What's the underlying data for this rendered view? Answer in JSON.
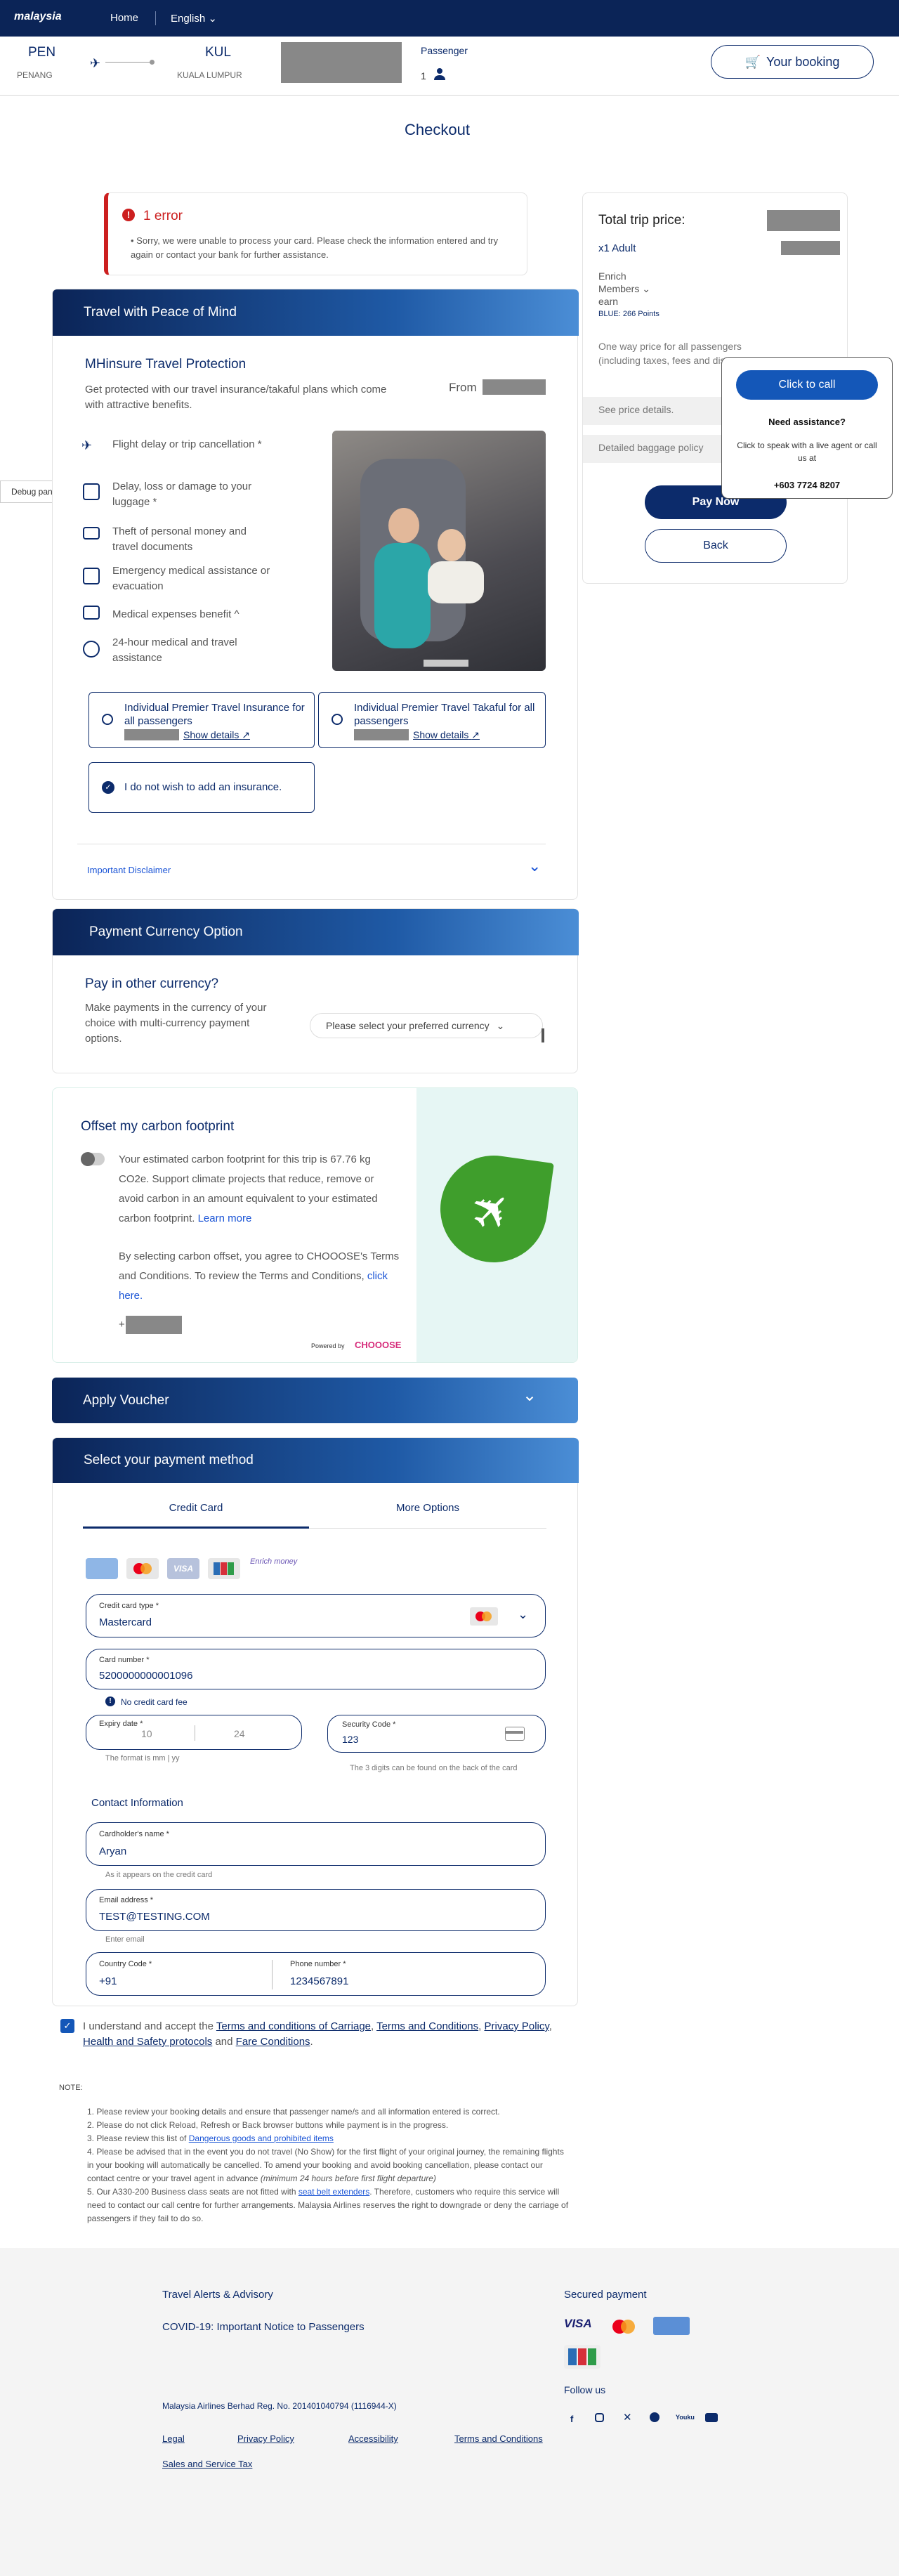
{
  "topbar": {
    "logo": "malaysia",
    "home": "Home",
    "language": "English"
  },
  "flight": {
    "origin_code": "PEN",
    "origin_city": "PENANG",
    "dest_code": "KUL",
    "dest_city": "KUALA LUMPUR",
    "passenger_label": "Passenger",
    "passenger_count": "1",
    "booking_button": "Your booking"
  },
  "page_title": "Checkout",
  "error": {
    "title": "1 error",
    "message": "Sorry, we were unable to process your card. Please check the information entered and try again or contact your bank for further assistance."
  },
  "summary": {
    "total_label": "Total trip price:",
    "adult": "x1 Adult",
    "enrich_line1": "Enrich",
    "enrich_line2": "Members",
    "enrich_line3": "earn",
    "blue_points": "BLUE: 266 Points",
    "oneway_note": "One way price for all passengers (including taxes, fees and discounts).",
    "see_price": "See price details.",
    "baggage": "Detailed baggage policy",
    "pay_now": "Pay Now",
    "back": "Back"
  },
  "assist": {
    "call_button": "Click to call",
    "need": "Need assistance?",
    "text": "Click to speak with a live agent or call us at",
    "phone": "+603 7724 8207"
  },
  "debug": "Debug panel",
  "insurance": {
    "banner": "Travel with Peace of Mind",
    "title": "MHinsure Travel Protection",
    "desc": "Get protected with our travel insurance/takaful plans which come with attractive benefits.",
    "from": "From",
    "features": [
      "Flight delay or trip cancellation *",
      "Delay, loss or damage to your luggage *",
      "Theft of personal money and travel documents",
      "Emergency medical assistance or evacuation",
      "Medical expenses benefit ^",
      "24-hour medical and travel assistance"
    ],
    "option1": "Individual Premier Travel Insurance for all passengers",
    "option2": "Individual Premier Travel Takaful for all passengers",
    "show_details": "Show details",
    "no_insurance": "I do not wish to add an insurance.",
    "disclaimer": "Important Disclaimer"
  },
  "currency": {
    "banner": "Payment Currency Option",
    "title": "Pay in other currency?",
    "desc": "Make payments in the currency of your choice with multi-currency payment options.",
    "placeholder": "Please select your preferred currency"
  },
  "carbon": {
    "title": "Offset my carbon footprint",
    "text1": "Your estimated carbon footprint for this trip is 67.76 kg CO2e. Support climate projects that reduce, remove or avoid carbon in an amount equivalent to your estimated carbon footprint.",
    "learn": "Learn more",
    "text2": "By selecting carbon offset, you agree to CHOOOSE's Terms and Conditions. To review the Terms and Conditions,",
    "click": "click here.",
    "plus": "+",
    "powered": "Powered by",
    "brand": "CHOOOSE"
  },
  "voucher": {
    "banner": "Apply Voucher"
  },
  "payment": {
    "banner": "Select your payment method",
    "tab_card": "Credit Card",
    "tab_more": "More Options",
    "card_type_label": "Credit card type *",
    "card_type": "Mastercard",
    "card_number_label": "Card number *",
    "card_number": "5200000000001096",
    "fee": "No credit card fee",
    "expiry_label": "Expiry date *",
    "expiry_month": "10",
    "expiry_year": "24",
    "expiry_hint": "The format is mm | yy",
    "cvv_label": "Security Code *",
    "cvv": "123",
    "cvv_hint": "The 3 digits can be found on the back of the card",
    "contact_title": "Contact Information",
    "name_label": "Cardholder's name *",
    "name": "Aryan",
    "name_hint": "As it appears on the credit card",
    "email_label": "Email address *",
    "email": "TEST@TESTING.COM",
    "email_hint": "Enter email",
    "country_label": "Country Code *",
    "country": "+91",
    "phone_label": "Phone number *",
    "phone": "1234567891",
    "brand_enrich": "Enrich money"
  },
  "terms": {
    "prefix": "I understand and accept the",
    "l1": "Terms and conditions of Carriage",
    "c1": ",",
    "l2": "Terms and Conditions",
    "c2": ",",
    "l3": "Privacy Policy",
    "c3": ",",
    "l4": "Health and Safety protocols",
    "and": "and",
    "l5": "Fare Conditions",
    "end": "."
  },
  "notes": {
    "title": "NOTE:",
    "n1": "1. Please review your booking details and ensure that passenger name/s and all information entered is correct.",
    "n2": "2. Please do not click Reload, Refresh or Back browser buttons while payment is in the progress.",
    "n3a": "3. Please review this list of",
    "n3b": "Dangerous goods and prohibited items",
    "n4": "4. Please be advised that in the event you do not travel (No Show) for the first flight of your original journey, the remaining flights in your booking will automatically be cancelled. To amend your booking and avoid booking cancellation, please contact our contact centre or your travel agent in advance",
    "n4i": "(minimum 24 hours before first flight departure)",
    "n5a": "5. Our A330-200 Business class seats are not fitted with",
    "n5b": "seat belt extenders",
    "n5c": ". Therefore, customers who require this service will need to contact our call centre for further arrangements. Malaysia Airlines reserves the right to downgrade or deny the carriage of passengers if they fail to do so."
  },
  "footer": {
    "alerts": "Travel Alerts & Advisory",
    "covid": "COVID-19: Important Notice to Passengers",
    "secured": "Secured payment",
    "follow": "Follow us",
    "reg": "Malaysia Airlines Berhad Reg. No. 201401040794 (1116944-X)",
    "legal": "Legal",
    "privacy": "Privacy Policy",
    "access": "Accessibility",
    "tnc": "Terms and Conditions",
    "sst": "Sales and Service Tax",
    "visa": "VISA",
    "brand_colors": {
      "navy": "#0b2457",
      "blue": "#1a54d6",
      "error": "#cc1f1f"
    }
  }
}
